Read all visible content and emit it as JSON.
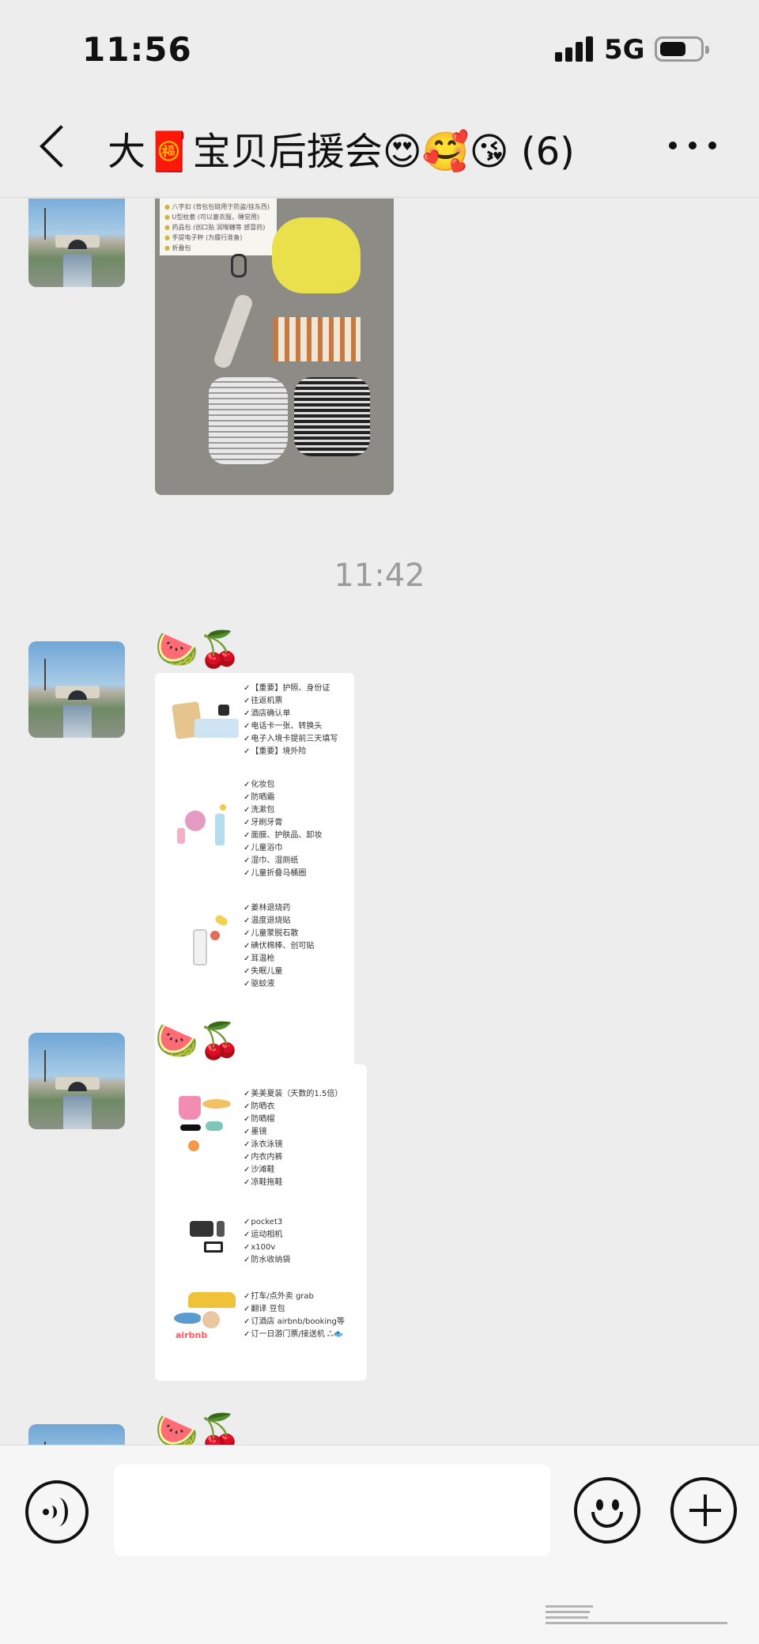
{
  "status_bar": {
    "time": "11:56",
    "network": "5G"
  },
  "header": {
    "title": "大🧧宝贝后援会😍🥰😘 (6)"
  },
  "messages": {
    "photo_note_items": [
      "八字扣 (背包包链用于防盗/挂东西)",
      "U型枕套 (可以塞衣服，睡觉用)",
      "药品包 (创口贴 润喉糖等 感冒药)",
      "手提电子秤 (为履行准备)",
      "折叠包"
    ],
    "time_separator": "11:42",
    "emoji_caption": "🍉🍒",
    "card1": {
      "sections": [
        {
          "items": [
            "【重要】护照、身份证",
            "往返机票",
            "酒店确认单",
            "电话卡一张、转换头",
            "电子入境卡提前三天填写",
            "【重要】境外险"
          ]
        },
        {
          "items": [
            "化妆包",
            "防晒霜",
            "洗漱包",
            "牙刷牙膏",
            "面膜、护肤品、卸妆",
            "儿童浴巾",
            "湿巾、湿厕纸",
            "儿童折叠马桶圈"
          ]
        },
        {
          "items": [
            "姜林退烧药",
            "温度退烧贴",
            "儿童蒙脱石散",
            "碘伏棉棒、创可贴",
            "耳温枪",
            "失眠儿童",
            "驱蚊液"
          ]
        }
      ]
    },
    "card2": {
      "sections": [
        {
          "items": [
            "美美夏装（天数的1.5倍）",
            "防晒衣",
            "防晒帽",
            "墨镜",
            "泳衣泳镜",
            "内衣内裤",
            "沙滩鞋",
            "凉鞋拖鞋"
          ]
        },
        {
          "items": [
            "pocket3",
            "运动相机",
            "x100v",
            "防水收纳袋"
          ]
        },
        {
          "items": [
            "打车/点外卖 grab",
            "翻译 豆包",
            "订酒店 airbnb/booking等",
            "订一日游门票/接送机 ஃ🐟"
          ]
        }
      ],
      "logo_text": "airbnb"
    }
  },
  "input_bar": {
    "placeholder": ""
  }
}
